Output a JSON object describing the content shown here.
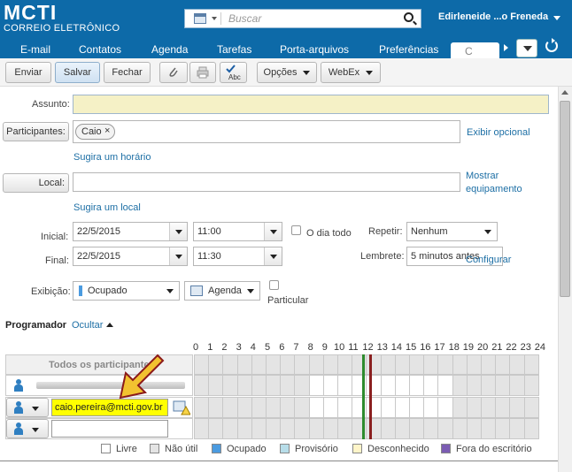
{
  "app": {
    "logo": "MCTI",
    "logo_sub": "CORREIO ELETRÔNICO",
    "user": "Edirleneide ...o Freneda"
  },
  "search": {
    "placeholder": "Buscar"
  },
  "nav": {
    "items": [
      "E-mail",
      "Contatos",
      "Agenda",
      "Tarefas",
      "Porta-arquivos",
      "Preferências"
    ],
    "active_tab": "C"
  },
  "toolbar": {
    "send": "Enviar",
    "save": "Salvar",
    "close": "Fechar",
    "options": "Opções",
    "webex": "WebEx",
    "spell_label": "Abc"
  },
  "form": {
    "subject_label": "Assunto:",
    "subject_value": "",
    "participants_button": "Participantes:",
    "participant_chip": "Caio",
    "show_optional": "Exibir opcional",
    "suggest_time": "Sugira um horário",
    "location_button": "Local:",
    "show_equipment_1": "Mostrar",
    "show_equipment_2": "equipamento",
    "suggest_location": "Sugira um local",
    "start_label": "Inicial:",
    "start_date": "22/5/2015",
    "start_time": "11:00",
    "all_day_label": "O dia todo",
    "repeat_label": "Repetir:",
    "repeat_value": "Nenhum",
    "end_label": "Final:",
    "end_date": "22/5/2015",
    "end_time": "11:30",
    "reminder_label": "Lembrete:",
    "reminder_value": "5 minutos antes",
    "configure_link": "Configurar",
    "display_label": "Exibição:",
    "display_value": "Ocupado",
    "calendar_value": "Agenda",
    "private_label": "Particular"
  },
  "scheduler": {
    "title": "Programador",
    "hide_link": "Ocultar",
    "hours": [
      "0",
      "1",
      "2",
      "3",
      "4",
      "5",
      "6",
      "7",
      "8",
      "9",
      "10",
      "11",
      "12",
      "13",
      "14",
      "15",
      "16",
      "17",
      "18",
      "19",
      "20",
      "21",
      "22",
      "23",
      "24"
    ],
    "all_participants": "Todos os participantes",
    "attendee_email": "caio.pereira@mcti.gov.br",
    "legend": [
      "Livre",
      "Não útil",
      "Ocupado",
      "Provisório",
      "Desconhecido",
      "Fora do escritório"
    ],
    "legend_colors": [
      "#ffffff",
      "#e4e4e4",
      "#4b9be0",
      "#b7dde9",
      "#fff5c9",
      "#7b5cb3"
    ]
  },
  "colors": {
    "header_bg": "#0d6aa8",
    "subject_bg": "#f5f1c6",
    "email_highlight": "#ffff00",
    "arrow": "#f2c230",
    "now_line": "#8a1f1f",
    "start_line": "#2e8b2e"
  }
}
